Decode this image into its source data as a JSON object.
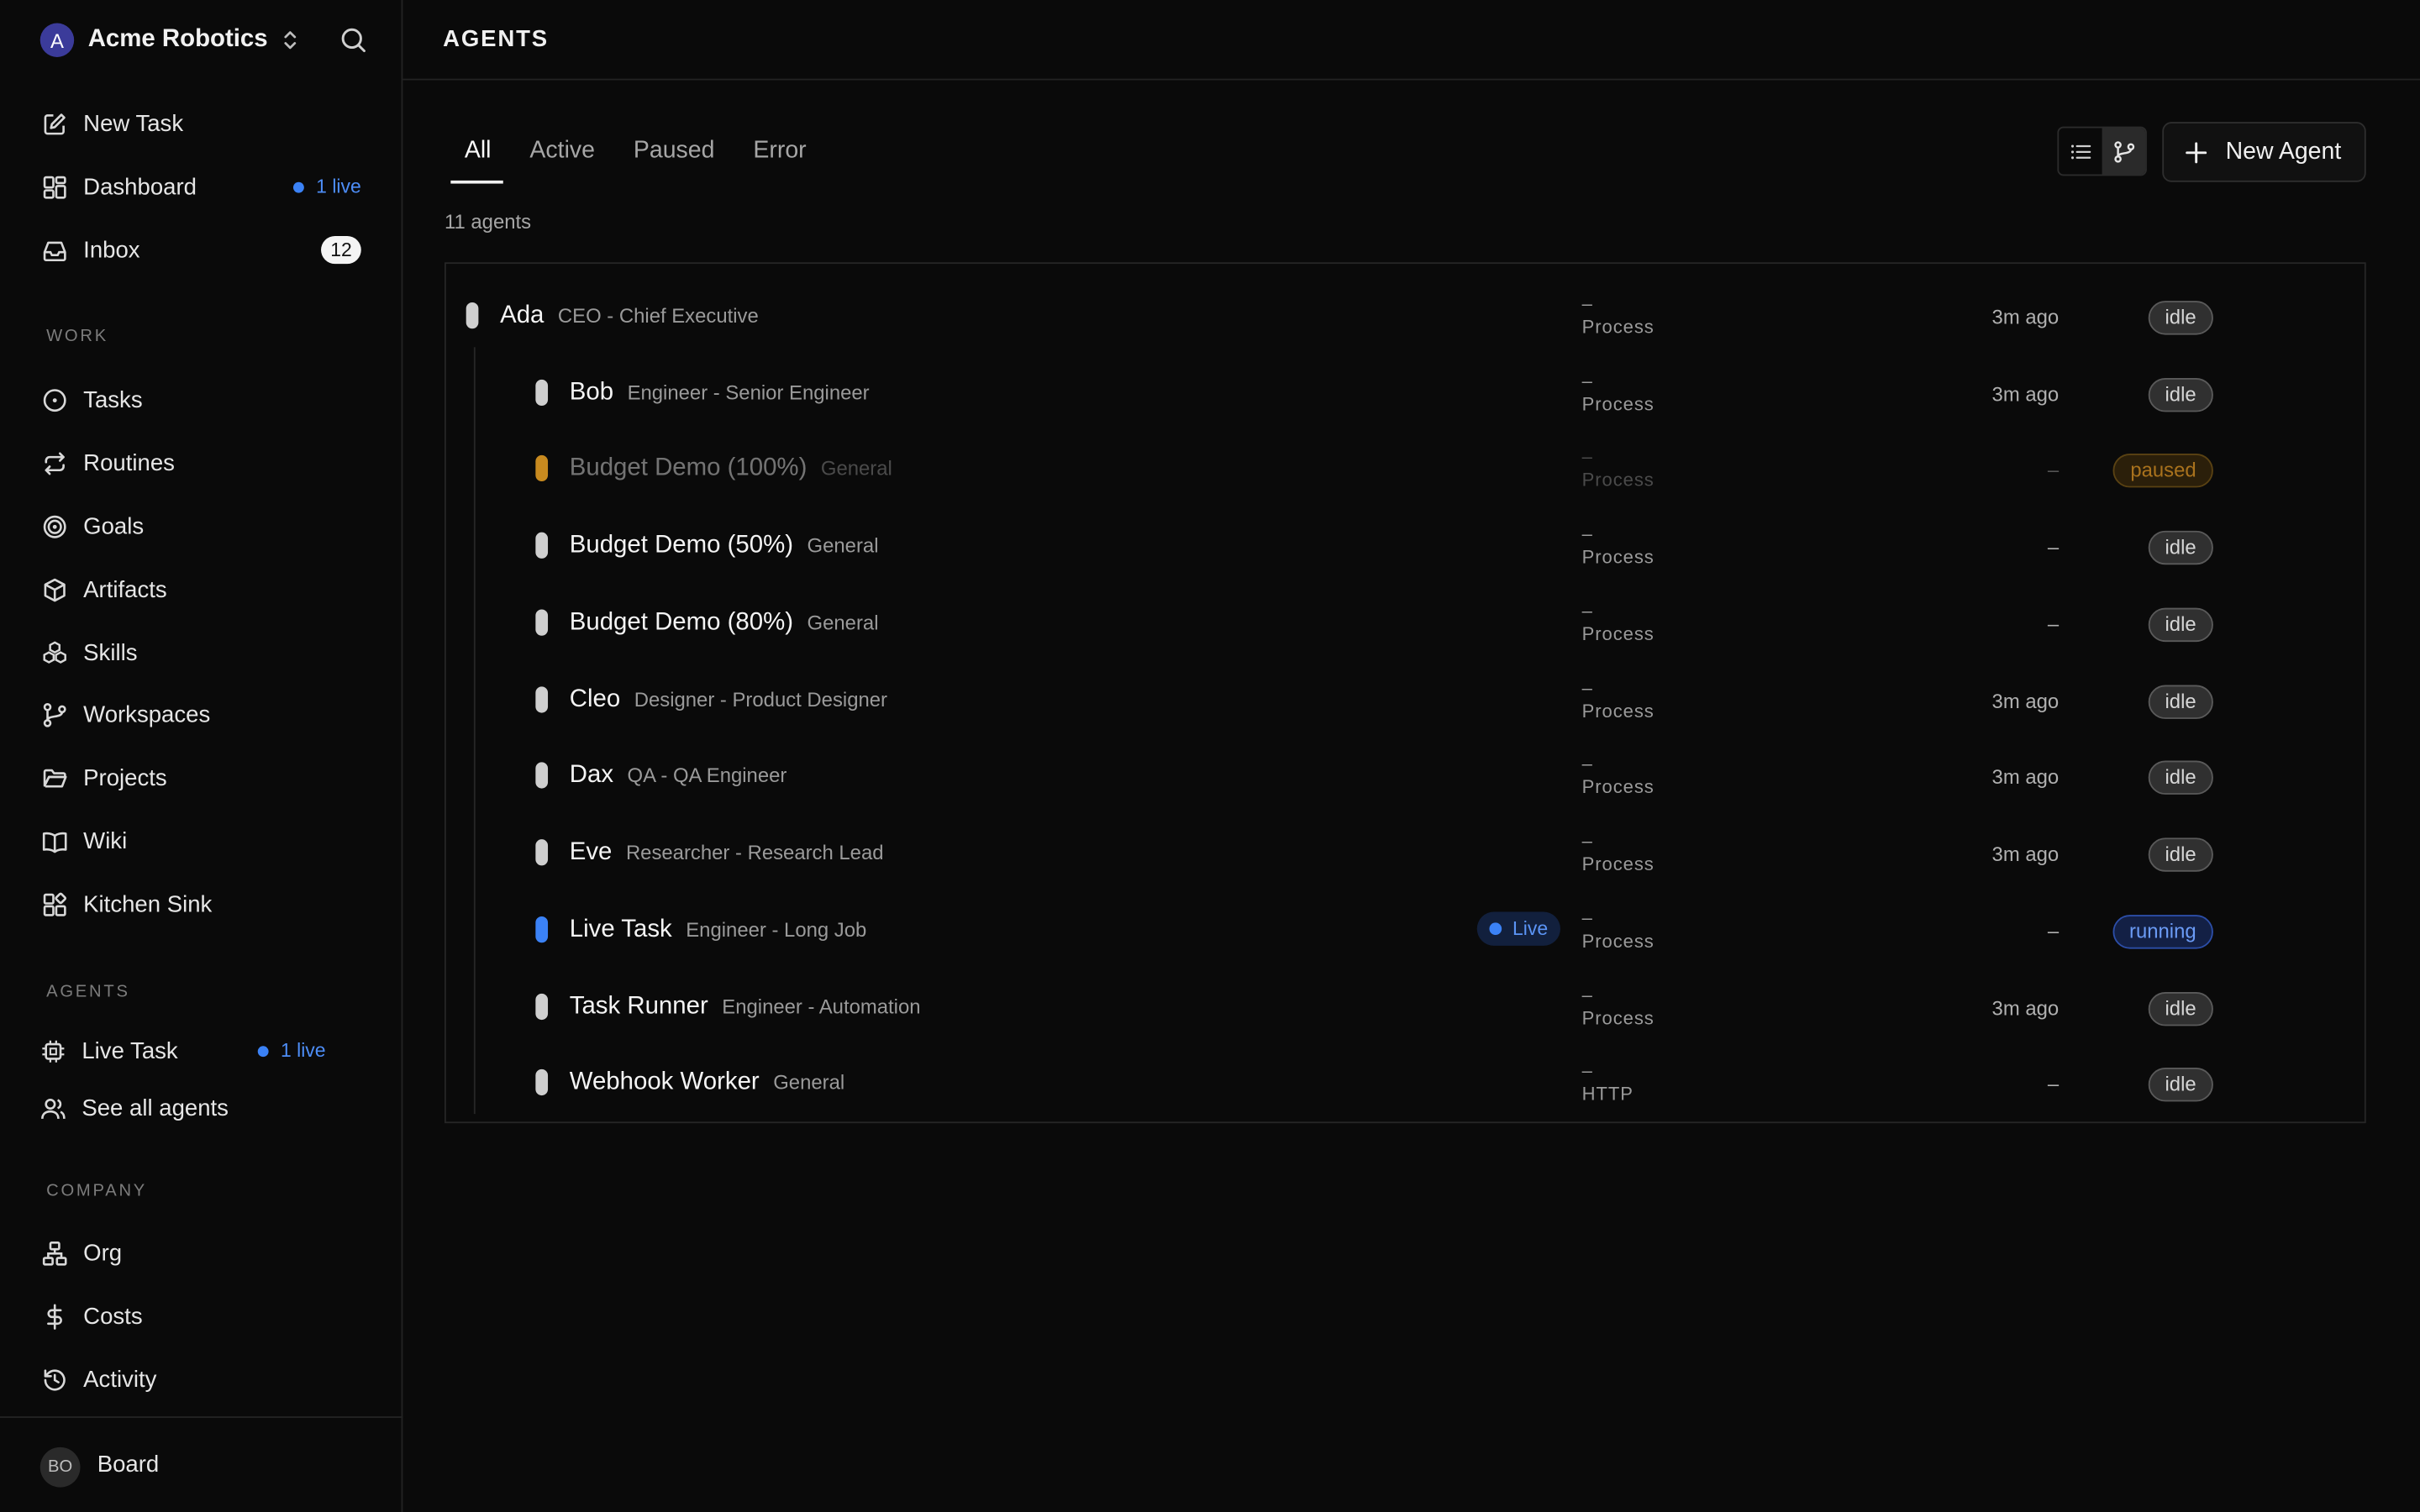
{
  "company": {
    "initial": "A",
    "name": "Acme Robotics"
  },
  "nav": {
    "new_task": "New Task",
    "dashboard": "Dashboard",
    "dashboard_live": "1 live",
    "inbox": "Inbox",
    "inbox_count": "12"
  },
  "sections": {
    "work": "WORK",
    "agents": "AGENTS",
    "company": "COMPANY"
  },
  "work_items": [
    "Tasks",
    "Routines",
    "Goals",
    "Artifacts",
    "Skills",
    "Workspaces",
    "Projects",
    "Wiki",
    "Kitchen Sink"
  ],
  "agents_nav": {
    "live_task": "Live Task",
    "live_task_badge": "1 live",
    "see_all": "See all agents"
  },
  "company_items": [
    "Org",
    "Costs",
    "Activity"
  ],
  "footer": {
    "avatar": "BO",
    "label": "Board"
  },
  "page": {
    "title": "AGENTS",
    "tabs": [
      "All",
      "Active",
      "Paused",
      "Error"
    ],
    "active_tab": "All",
    "count": "11 agents",
    "new_agent": "New Agent"
  },
  "agents": [
    {
      "name": "Ada",
      "role": "CEO - Chief Executive",
      "adapter_top": "–",
      "adapter": "Process",
      "last": "3m ago",
      "status": "idle"
    },
    {
      "name": "Bob",
      "role": "Engineer - Senior Engineer",
      "adapter_top": "–",
      "adapter": "Process",
      "last": "3m ago",
      "status": "idle"
    },
    {
      "name": "Budget Demo (100%)",
      "role": "General",
      "adapter_top": "–",
      "adapter": "Process",
      "last": "–",
      "status": "paused"
    },
    {
      "name": "Budget Demo (50%)",
      "role": "General",
      "adapter_top": "–",
      "adapter": "Process",
      "last": "–",
      "status": "idle"
    },
    {
      "name": "Budget Demo (80%)",
      "role": "General",
      "adapter_top": "–",
      "adapter": "Process",
      "last": "–",
      "status": "idle"
    },
    {
      "name": "Cleo",
      "role": "Designer - Product Designer",
      "adapter_top": "–",
      "adapter": "Process",
      "last": "3m ago",
      "status": "idle"
    },
    {
      "name": "Dax",
      "role": "QA - QA Engineer",
      "adapter_top": "–",
      "adapter": "Process",
      "last": "3m ago",
      "status": "idle"
    },
    {
      "name": "Eve",
      "role": "Researcher - Research Lead",
      "adapter_top": "–",
      "adapter": "Process",
      "last": "3m ago",
      "status": "idle"
    },
    {
      "name": "Live Task",
      "role": "Engineer - Long Job",
      "live": "Live",
      "adapter_top": "–",
      "adapter": "Process",
      "last": "–",
      "status": "running"
    },
    {
      "name": "Task Runner",
      "role": "Engineer - Automation",
      "adapter_top": "–",
      "adapter": "Process",
      "last": "3m ago",
      "status": "idle"
    },
    {
      "name": "Webhook Worker",
      "role": "General",
      "adapter_top": "–",
      "adapter": "HTTP",
      "last": "–",
      "status": "idle"
    }
  ],
  "icons": [
    "search-icon",
    "chevron-updown-icon",
    "pencil-square-icon",
    "grid-icon",
    "inbox-icon",
    "circle-dot-icon",
    "repeat-icon",
    "target-icon",
    "box-icon",
    "boxes-icon",
    "git-branch-icon",
    "folder-icon",
    "book-icon",
    "blocks-icon",
    "cpu-icon",
    "users-icon",
    "network-icon",
    "dollar-icon",
    "history-icon",
    "list-icon",
    "plus-icon"
  ],
  "colors": {
    "background": "#0a0a0a",
    "accent_blue": "#3b82f6",
    "paused": "#c88a1f"
  }
}
